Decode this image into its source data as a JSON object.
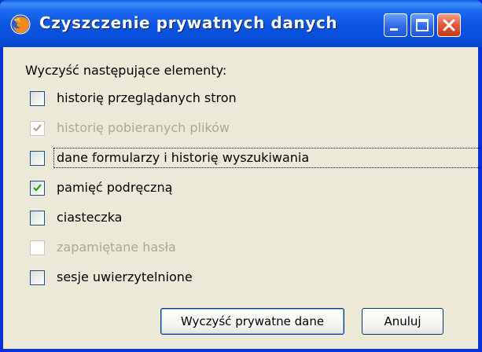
{
  "window": {
    "title": "Czyszczenie prywatnych danych",
    "app_icon": "firefox-icon"
  },
  "dialog": {
    "heading": "Wyczyść następujące elementy:",
    "options": [
      {
        "label": "historię przeglądanych stron",
        "checked": false,
        "enabled": true
      },
      {
        "label": "historię pobieranych plików",
        "checked": true,
        "enabled": false
      },
      {
        "label": "dane formularzy i historię wyszukiwania",
        "checked": false,
        "enabled": true,
        "focused": true
      },
      {
        "label": "pamięć podręczną",
        "checked": true,
        "enabled": true
      },
      {
        "label": "ciasteczka",
        "checked": false,
        "enabled": true
      },
      {
        "label": "zapamiętane hasła",
        "checked": false,
        "enabled": false
      },
      {
        "label": "sesje uwierzytelnione",
        "checked": false,
        "enabled": true
      }
    ],
    "clear_button": "Wyczyść prywatne dane",
    "cancel_button": "Anuluj"
  }
}
